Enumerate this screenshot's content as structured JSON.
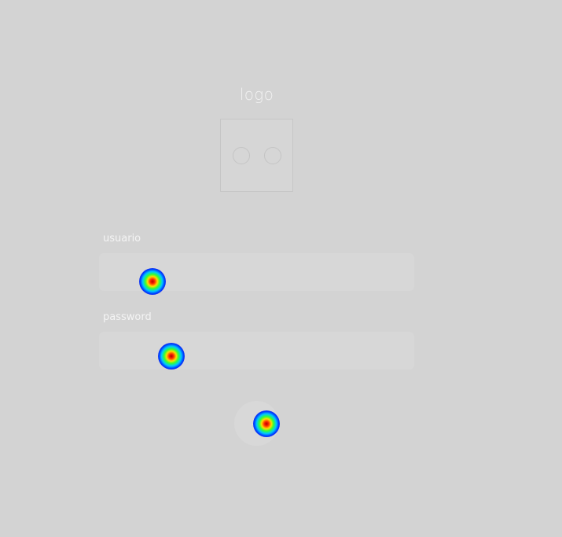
{
  "logo": {
    "title": "logo",
    "icon": "logo-face-icon"
  },
  "form": {
    "username_label": "usuario",
    "username_value": "",
    "password_label": "password",
    "password_value": ""
  },
  "submit": {
    "icon": "arrow-right-icon",
    "glyph": "→"
  },
  "heatmap": {
    "colors": [
      "#b30000",
      "#ff2a00",
      "#ffdd00",
      "#33ff33",
      "#00c8ff",
      "#0033ff"
    ]
  }
}
